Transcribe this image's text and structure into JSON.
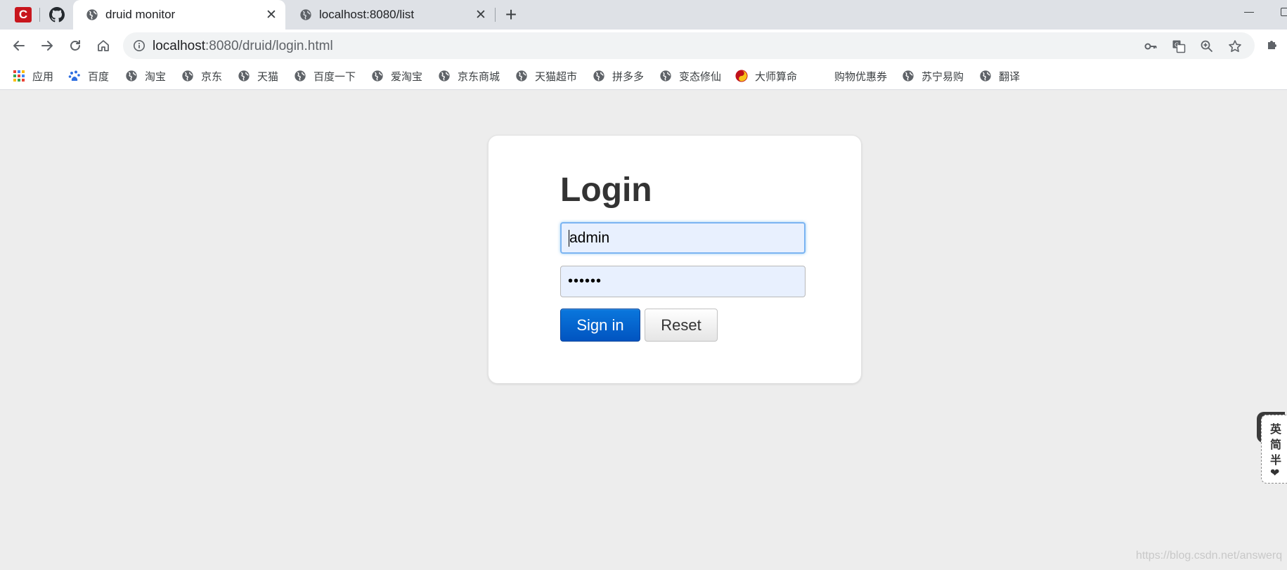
{
  "browser": {
    "tabs": [
      {
        "title": "druid monitor",
        "active": true
      },
      {
        "title": "localhost:8080/list",
        "active": false
      }
    ],
    "pinned_tab_letter": "C",
    "new_tab_symbol": "+",
    "close_symbol": "✕",
    "address": {
      "host": "localhost",
      "path": ":8080/druid/login.html"
    },
    "bookmarks": [
      {
        "label": "应用",
        "icon": "apps-grid-icon"
      },
      {
        "label": "百度",
        "icon": "baidu-paw-icon"
      },
      {
        "label": "淘宝",
        "icon": "globe-icon"
      },
      {
        "label": "京东",
        "icon": "globe-icon"
      },
      {
        "label": "天猫",
        "icon": "globe-icon"
      },
      {
        "label": "百度一下",
        "icon": "globe-icon"
      },
      {
        "label": "爱淘宝",
        "icon": "globe-icon"
      },
      {
        "label": "京东商城",
        "icon": "globe-icon"
      },
      {
        "label": "天猫超市",
        "icon": "globe-icon"
      },
      {
        "label": "拼多多",
        "icon": "globe-icon"
      },
      {
        "label": "变态修仙",
        "icon": "globe-icon"
      },
      {
        "label": "大师算命",
        "icon": "yin-yang-icon"
      },
      {
        "label": "购物优惠券",
        "icon": "none"
      },
      {
        "label": "苏宁易购",
        "icon": "globe-icon"
      },
      {
        "label": "翻译",
        "icon": "globe-icon"
      }
    ]
  },
  "login": {
    "title": "Login",
    "username_value": "admin",
    "password_mask": "••••••",
    "signin_label": "Sign in",
    "reset_label": "Reset"
  },
  "side_widget": {
    "chars": [
      "英",
      "简",
      "半",
      "❤"
    ]
  },
  "watermark": "https://blog.csdn.net/answerq",
  "colors": {
    "page_bg": "#ededed",
    "signin_blue": "#0a6ad6",
    "input_bg": "#e8f0fe"
  }
}
